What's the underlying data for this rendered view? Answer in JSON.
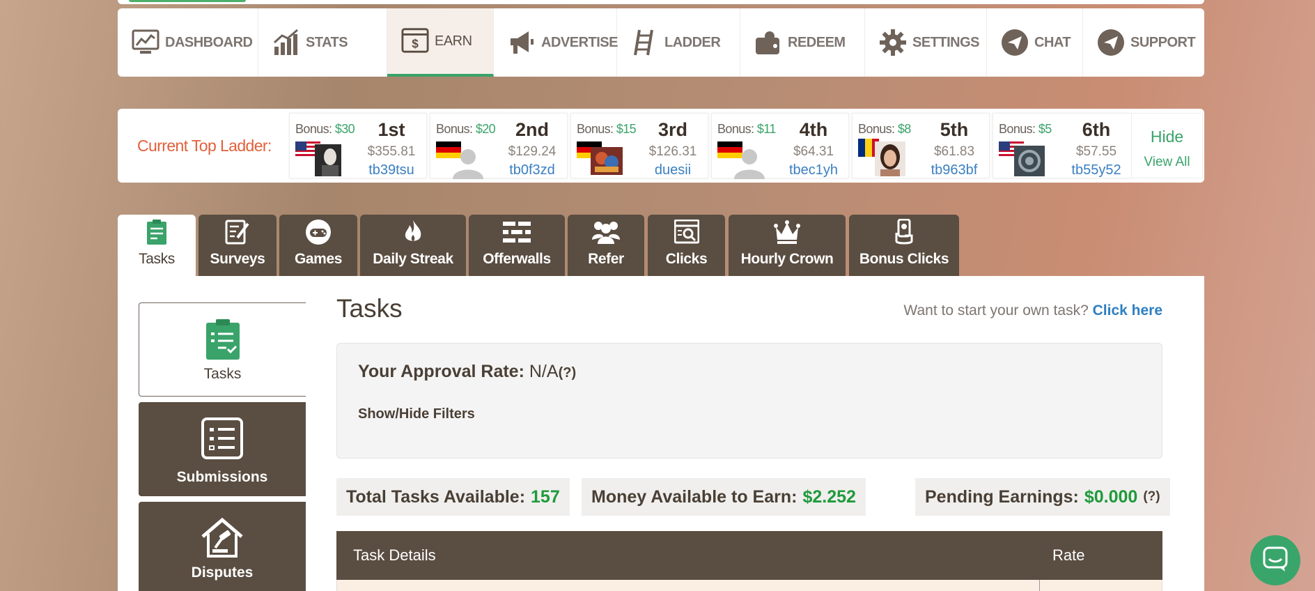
{
  "nav": [
    {
      "label": "DASHBOARD",
      "icon": "dashboard-icon"
    },
    {
      "label": "STATS",
      "icon": "stats-icon"
    },
    {
      "label": "EARN",
      "icon": "earn-icon",
      "active": true
    },
    {
      "label": "ADVERTISE",
      "icon": "megaphone-icon"
    },
    {
      "label": "LADDER",
      "icon": "ladder-icon"
    },
    {
      "label": "REDEEM",
      "icon": "wallet-icon"
    },
    {
      "label": "SETTINGS",
      "icon": "gear-icon"
    },
    {
      "label": "CHAT",
      "icon": "paper-plane-icon"
    },
    {
      "label": "SUPPORT",
      "icon": "paper-plane-icon"
    }
  ],
  "ladder": {
    "title": "Current Top Ladder:",
    "bonus_label": "Bonus:",
    "entries": [
      {
        "bonus": "$30",
        "rank": "1st",
        "amount": "$355.81",
        "user": "tb39tsu",
        "flag": "us"
      },
      {
        "bonus": "$20",
        "rank": "2nd",
        "amount": "$129.24",
        "user": "tb0f3zd",
        "flag": "de"
      },
      {
        "bonus": "$15",
        "rank": "3rd",
        "amount": "$126.31",
        "user": "duesii",
        "flag": "de"
      },
      {
        "bonus": "$11",
        "rank": "4th",
        "amount": "$64.31",
        "user": "tbec1yh",
        "flag": "de"
      },
      {
        "bonus": "$8",
        "rank": "5th",
        "amount": "$61.83",
        "user": "tb963bf",
        "flag": "ro"
      },
      {
        "bonus": "$5",
        "rank": "6th",
        "amount": "$57.55",
        "user": "tb55y52",
        "flag": "us"
      }
    ],
    "hide": "Hide",
    "view_all": "View All"
  },
  "tabs": [
    {
      "label": "Tasks",
      "icon": "clipboard-icon",
      "active": true
    },
    {
      "label": "Surveys",
      "icon": "survey-icon"
    },
    {
      "label": "Games",
      "icon": "gamepad-icon"
    },
    {
      "label": "Daily Streak",
      "icon": "flame-icon"
    },
    {
      "label": "Offerwalls",
      "icon": "brick-wall-icon"
    },
    {
      "label": "Refer",
      "icon": "users-icon"
    },
    {
      "label": "Clicks",
      "icon": "browser-search-icon"
    },
    {
      "label": "Hourly Crown",
      "icon": "crown-icon"
    },
    {
      "label": "Bonus Clicks",
      "icon": "hand-coin-icon"
    }
  ],
  "sidebar": [
    {
      "label": "Tasks",
      "icon": "clipboard-icon",
      "active": true
    },
    {
      "label": "Submissions",
      "icon": "list-icon"
    },
    {
      "label": "Disputes",
      "icon": "gavel-house-icon"
    }
  ],
  "main": {
    "title": "Tasks",
    "own_task_prompt": "Want to start your own task?",
    "own_task_link": "Click here",
    "approval_label": "Your Approval Rate:",
    "approval_value": "N/A",
    "help": "(?)",
    "filters_toggle": "Show/Hide Filters",
    "total_label": "Total Tasks Available:",
    "total_value": "157",
    "money_label": "Money Available to Earn:",
    "money_value": "$2.252",
    "pending_label": "Pending Earnings:",
    "pending_value": "$0.000",
    "col_details": "Task Details",
    "col_rate": "Rate"
  },
  "colors": {
    "brown": "#5a4d41",
    "green": "#3aa36a",
    "orange": "#e2603a",
    "link": "#2f7fc0"
  }
}
